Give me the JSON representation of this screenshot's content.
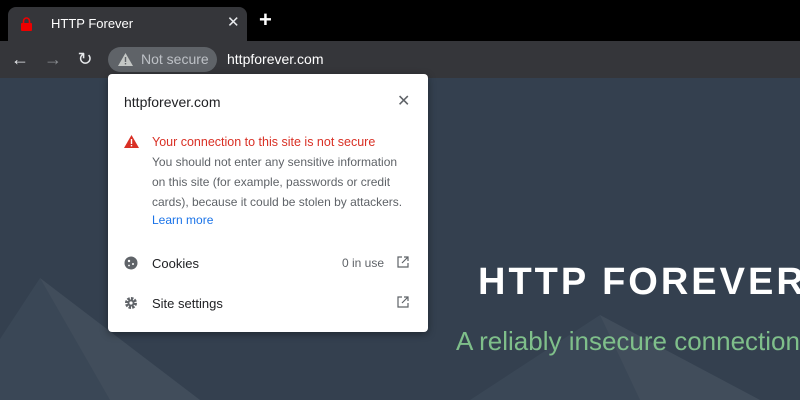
{
  "tab": {
    "title": "HTTP Forever",
    "close_icon": "close-icon",
    "favicon": "red-lock-icon"
  },
  "toolbar": {
    "security_chip": "Not secure",
    "url": "httpforever.com"
  },
  "page": {
    "heading": "HTTP FOREVER",
    "subheading": "A reliably insecure connection",
    "bg_color": "#34404f",
    "sub_color": "#7fbf8a"
  },
  "popup": {
    "host": "httpforever.com",
    "warning_title": "Your connection to this site is not secure",
    "warning_text": "You should not enter any sensitive information on this site (for example, passwords or credit cards), because it could be stolen by attackers.",
    "learn_more": "Learn more",
    "rows": [
      {
        "label": "Cookies",
        "value": "0 in use"
      },
      {
        "label": "Site settings"
      }
    ]
  },
  "colors": {
    "warning": "#d93025",
    "link": "#1a73e8"
  }
}
